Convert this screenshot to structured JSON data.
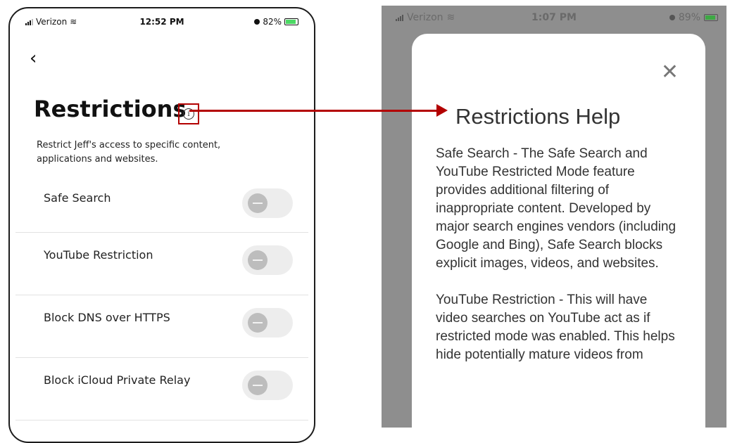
{
  "left_screen": {
    "status": {
      "carrier": "Verizon",
      "time": "12:52 PM",
      "battery": "82%"
    },
    "back_glyph": "‹",
    "title": "Restrictions",
    "info_glyph": "i",
    "subtitle": "Restrict Jeff's access to specific content, applications and websites.",
    "toggles": [
      {
        "label": "Safe Search",
        "enabled": false
      },
      {
        "label": "YouTube Restriction",
        "enabled": false
      },
      {
        "label": "Block DNS over HTTPS",
        "enabled": false
      },
      {
        "label": "Block iCloud Private Relay",
        "enabled": false
      }
    ]
  },
  "right_screen": {
    "status": {
      "carrier": "Verizon",
      "time": "1:07 PM",
      "battery": "89%"
    },
    "close_glyph": "✕",
    "title": "Restrictions Help",
    "paragraphs": [
      "Safe Search - The Safe Search and YouTube Restricted Mode feature provides additional filtering of inappropriate content. Developed by major search engines vendors (including Google and Bing), Safe Search blocks explicit images, videos, and websites.",
      "YouTube Restriction - This will have video searches on YouTube act as if restricted mode was enabled. This helps hide potentially mature videos from"
    ]
  },
  "colors": {
    "annotation": "#b30000",
    "toggle_off": "#ededed",
    "knob": "#bdbdbd",
    "overlay": "#8e8e8e"
  },
  "icons": [
    "back-chevron-icon",
    "info-icon",
    "close-icon",
    "signal-icon",
    "wifi-icon",
    "battery-icon",
    "alarm-icon"
  ]
}
